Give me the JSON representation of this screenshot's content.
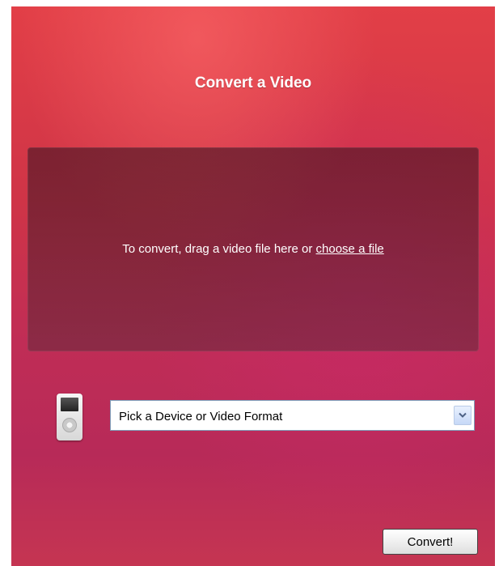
{
  "header": {
    "title": "Convert a Video"
  },
  "drop_zone": {
    "instruction": "To convert, drag a video file here or",
    "choose_link": "choose a file"
  },
  "format_picker": {
    "icon": "ipod-icon",
    "selected_value": "Pick a Device or Video Format"
  },
  "actions": {
    "convert_label": "Convert!"
  },
  "colors": {
    "background_top": "#e23f47",
    "background_bottom": "#b72a58",
    "text": "#ffffff"
  }
}
